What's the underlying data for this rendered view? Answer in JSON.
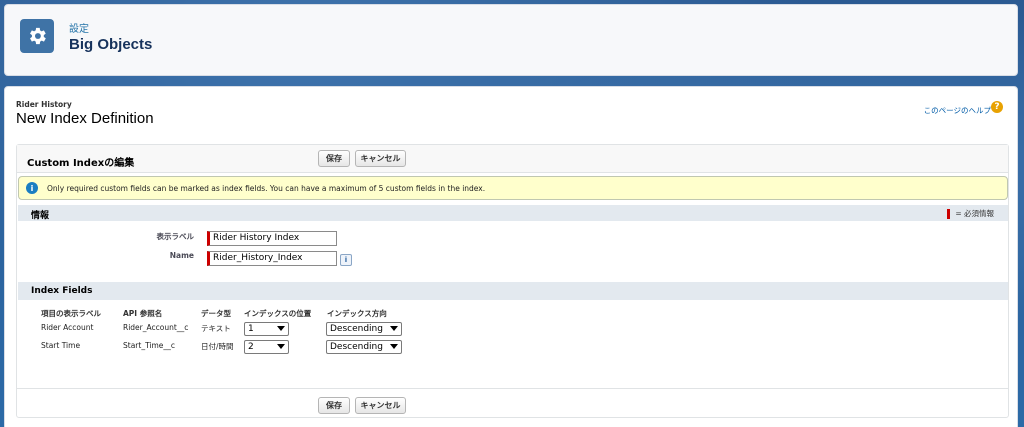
{
  "header": {
    "subtitle": "設定",
    "title": "Big Objects",
    "icon": "gear-icon"
  },
  "page": {
    "object_name": "Rider History",
    "title": "New Index Definition",
    "help_link": "このページのヘルプ"
  },
  "block": {
    "title": "Custom Indexの編集",
    "save_label": "保存",
    "cancel_label": "キャンセル"
  },
  "info": {
    "message": "Only required custom fields can be marked as index fields. You can have a maximum of 5 custom fields in the index."
  },
  "info_section": {
    "title": "情報",
    "required_legend": "= 必須情報"
  },
  "fields": {
    "label_label": "表示ラベル",
    "label_value": "Rider History Index",
    "name_label": "Name",
    "name_value": "Rider_History_Index"
  },
  "index_fields": {
    "title": "Index Fields",
    "columns": [
      "項目の表示ラベル",
      "API 参照名",
      "データ型",
      "インデックスの位置",
      "インデックス方向"
    ],
    "rows": [
      {
        "label": "Rider Account",
        "api": "Rider_Account__c",
        "type": "テキスト",
        "position": "1",
        "direction": "Descending"
      },
      {
        "label": "Start Time",
        "api": "Start_Time__c",
        "type": "日付/時間",
        "position": "2",
        "direction": "Descending"
      }
    ]
  },
  "colors": {
    "header_icon_bg": "#3f73a6",
    "required_red": "#cc0000",
    "info_bg": "#ffffcc"
  }
}
